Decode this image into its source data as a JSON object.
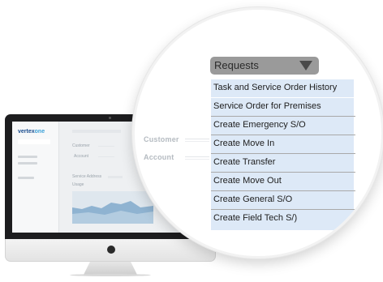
{
  "brand": {
    "part1": "vertex",
    "part2": "one"
  },
  "mini_form": {
    "customer_label": "Customer",
    "account_label": "Account",
    "service_address_label": "Service Address",
    "usage_label": "Usage"
  },
  "lens_fields": {
    "customer": "Customer",
    "account": "Account"
  },
  "requests": {
    "label": "Requests",
    "items": [
      "Task and Service Order History",
      "Service Order for Premises",
      "Create Emergency S/O",
      "Create Move In",
      "Create Transfer",
      "Create Move Out",
      "Create General S/O",
      "Create Field Tech S/)"
    ]
  },
  "colors": {
    "menu_bg": "#dde9f7",
    "requests_button": "#9a9a9a",
    "brand_dark": "#1a4d8f",
    "brand_light": "#3aa0d8",
    "chart_fill": "#8fb3d1"
  },
  "icons": {
    "dropdown": "triangle-down-icon"
  }
}
